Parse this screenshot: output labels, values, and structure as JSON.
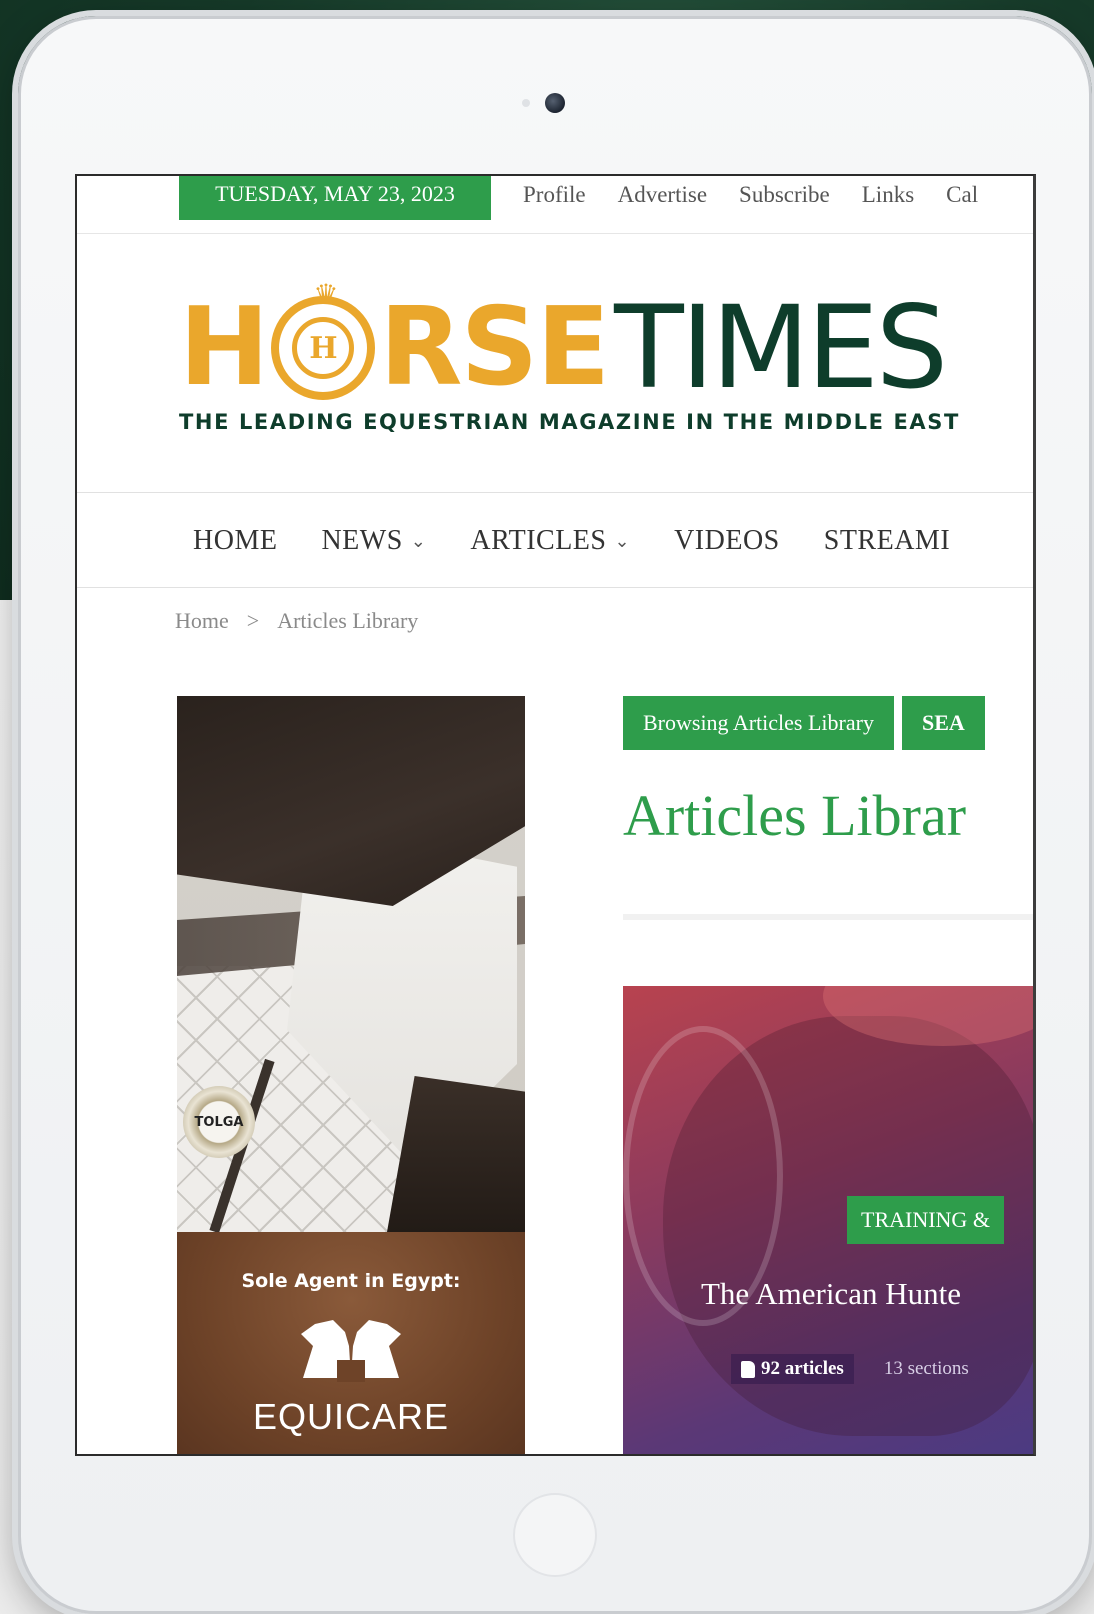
{
  "topbar": {
    "date": "TUESDAY, MAY 23, 2023",
    "links": [
      "Profile",
      "Advertise",
      "Subscribe",
      "Links",
      "Cal"
    ]
  },
  "logo": {
    "word_horse_left": "H",
    "crest_monogram": "H",
    "word_horse_right": "RSE",
    "word_times": "TIMES",
    "tagline": "THE LEADING EQUESTRIAN MAGAZINE IN THE MIDDLE EAST"
  },
  "nav": {
    "items": [
      {
        "label": "HOME",
        "has_dropdown": false
      },
      {
        "label": "NEWS",
        "has_dropdown": true
      },
      {
        "label": "ARTICLES",
        "has_dropdown": true
      },
      {
        "label": "VIDEOS",
        "has_dropdown": false
      },
      {
        "label": "STREAMI",
        "has_dropdown": false
      }
    ],
    "chevron": "⌄"
  },
  "breadcrumb": {
    "home": "Home",
    "separator": ">",
    "current": "Articles Library"
  },
  "ad": {
    "badge_text": "TOLGA",
    "sole_agent": "Sole Agent in Egypt:",
    "brand": "EQUICARE"
  },
  "main": {
    "browsing_label": "Browsing Articles Library",
    "search_label": "SEA",
    "title": "Articles Librar",
    "feature": {
      "category": "TRAINING &",
      "title": "The American Hunte",
      "articles": "92 articles",
      "sections": "13 sections"
    }
  },
  "colors": {
    "accent_green": "#2e9d4b",
    "logo_gold": "#eaa72c",
    "logo_dark_green": "#0e3d2b"
  }
}
